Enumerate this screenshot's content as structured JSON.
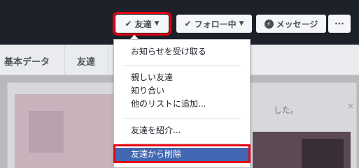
{
  "header": {
    "friend_button": "友達",
    "follow_button": "フォロー中",
    "message_button": "メッセージ",
    "more_button": "···"
  },
  "nav": {
    "items": [
      "基本データ",
      "友達"
    ]
  },
  "card": {
    "text": "した。",
    "close": "×"
  },
  "menu": {
    "items": [
      "お知らせを受け取る",
      "親しい友達",
      "知り合い",
      "他のリストに追加...",
      "友達を紹介...",
      "友達から削除"
    ],
    "selected": "友達から削除"
  },
  "colors": {
    "topbar": "#1d2129",
    "highlight": "#e60012",
    "selected": "#4267b2"
  }
}
